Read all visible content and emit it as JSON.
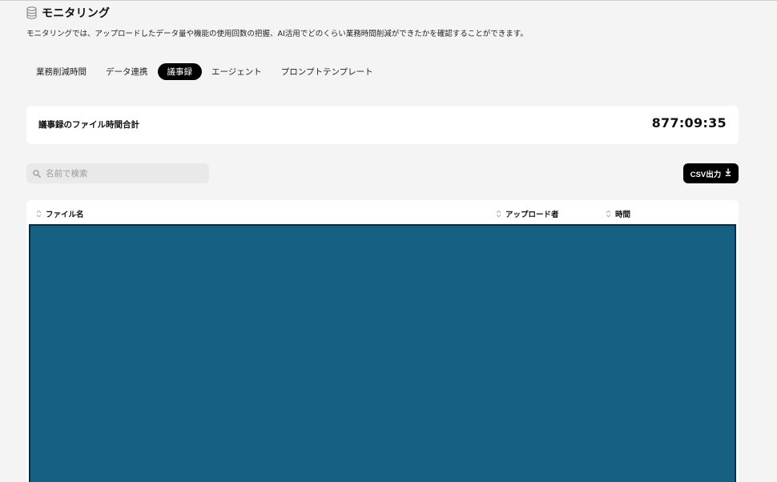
{
  "header": {
    "title": "モニタリング",
    "icon": "database-icon",
    "description": "モニタリングでは、アップロードしたデータ量や機能の使用回数の把握、AI活用でどのくらい業務時間削減ができたかを確認することができます。"
  },
  "tabs": [
    {
      "label": "業務削減時間",
      "active": false
    },
    {
      "label": "データ連携",
      "active": false
    },
    {
      "label": "議事録",
      "active": true
    },
    {
      "label": "エージェント",
      "active": false
    },
    {
      "label": "プロンプトテンプレート",
      "active": false
    }
  ],
  "summary": {
    "label": "議事録のファイル時間合計",
    "value": "877:09:35"
  },
  "search": {
    "placeholder": "名前で検索",
    "value": ""
  },
  "toolbar": {
    "csv_label": "CSV出力"
  },
  "table": {
    "columns": [
      "ファイル名",
      "アップロード者",
      "時間"
    ],
    "body_color": "#166083"
  },
  "colors": {
    "accent": "#000000",
    "page_bg": "#f4f4f4",
    "card_bg": "#ffffff"
  }
}
